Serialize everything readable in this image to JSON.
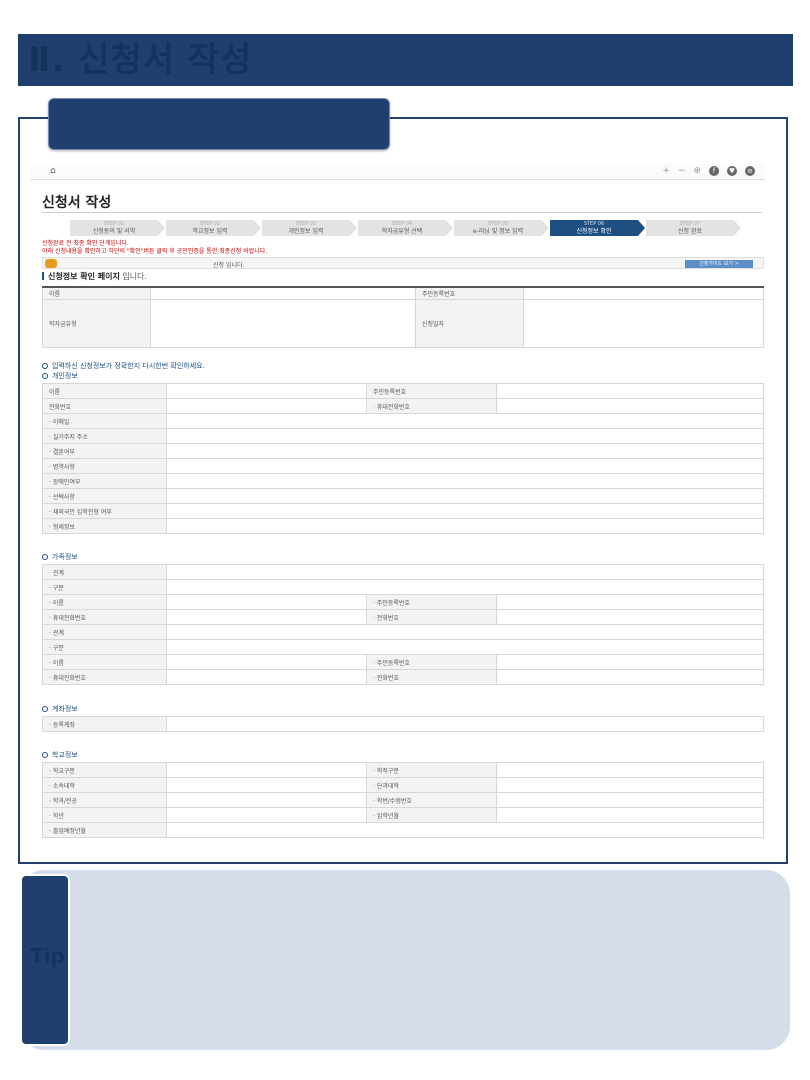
{
  "header": {
    "title": "Ⅱ. 신청서 작성"
  },
  "toolbar": {
    "home_icon": "home-icon",
    "icons": [
      "+",
      "−",
      "⊕",
      "f",
      "♥",
      "≡"
    ]
  },
  "page": {
    "heading": "신청서 작성",
    "steps": [
      {
        "no": "STEP 01",
        "label": "신청동의 및 서약"
      },
      {
        "no": "STEP 02",
        "label": "학교정보 입력"
      },
      {
        "no": "STEP 03",
        "label": "개인정보 입력"
      },
      {
        "no": "STEP 04",
        "label": "학자금유형 선택"
      },
      {
        "no": "STEP 05",
        "label": "e-러닝 및 정보 입력"
      },
      {
        "no": "STEP 06",
        "label": "신청정보 확인"
      },
      {
        "no": "STEP 07",
        "label": "신청 완료"
      }
    ],
    "notice_line1": "신청완료 전 최종 확인 단계입니다.",
    "notice_line2": "아래 신청내용을 확인하고 하단의 \"확인\"버튼 클릭 후 공인인증을 통한 최종신청 바랍니다.",
    "info_text": "신청 입니다.",
    "info_button": "신청가이드 보기 >",
    "section_title_bold": "신청정보 확인 페이지",
    "section_title_rest": " 입니다.",
    "top_table": {
      "name": "이름",
      "rrn": "주민등록번호",
      "loan_type": "학자금유형",
      "apply_date": "신청일자"
    },
    "check_msg": "입력하신 신청정보가 정확한지 다시한번 확인하세요."
  },
  "personal": {
    "title": "개인정보",
    "rows": [
      [
        "이름",
        "주민등록번호"
      ],
      [
        "전화번호",
        "· 휴대전화번호"
      ],
      [
        "· 이메일"
      ],
      [
        "· 실거주지 주소"
      ],
      [
        "· 결혼여부"
      ],
      [
        "· 병역사항"
      ],
      [
        "· 장애인여부"
      ],
      [
        "· 선택사항"
      ],
      [
        "· 재외국민 입학전형 여부"
      ],
      [
        "· 형제정보"
      ]
    ]
  },
  "family": {
    "title": "가족정보",
    "rows": [
      [
        "· 관계"
      ],
      [
        "· 구분"
      ],
      [
        "· 이름",
        "· 주민등록번호"
      ],
      [
        "· 휴대전화번호",
        "· 전화번호"
      ],
      [
        "· 관계"
      ],
      [
        "· 구분"
      ],
      [
        "· 이름",
        "· 주민등록번호"
      ],
      [
        "· 휴대전화번호",
        "· 전화번호"
      ]
    ]
  },
  "account": {
    "title": "계좌정보",
    "rows": [
      [
        "· 등록계좌"
      ]
    ]
  },
  "school": {
    "title": "학교정보",
    "rows": [
      [
        "· 학교구분",
        "· 학적구분"
      ],
      [
        "· 소속대학",
        "· 단과대학"
      ],
      [
        "· 학과/전공",
        "· 학번/수험번호"
      ],
      [
        "· 학년",
        "· 입학년월"
      ],
      [
        "· 졸업예정년월"
      ]
    ]
  },
  "tip": {
    "label": "Tip"
  },
  "colors": {
    "navy": "#1f3f6e",
    "active_step": "#1e4f82",
    "tip_bg": "#d5dcea",
    "notice": "#cc0000"
  }
}
